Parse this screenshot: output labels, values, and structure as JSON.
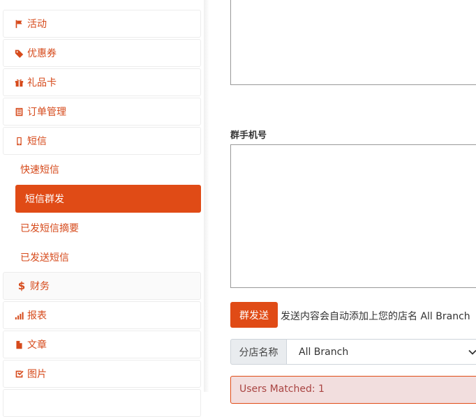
{
  "sidebar": {
    "items": [
      {
        "label": "活动",
        "icon": "flag-icon"
      },
      {
        "label": "优惠券",
        "icon": "tags-icon"
      },
      {
        "label": "礼品卡",
        "icon": "gift-icon"
      },
      {
        "label": "订单管理",
        "icon": "list-icon"
      },
      {
        "label": "短信",
        "icon": "mobile-icon"
      },
      {
        "label": "财务",
        "icon": "dollar-icon"
      },
      {
        "label": "报表",
        "icon": "bar-chart-icon"
      },
      {
        "label": "文章",
        "icon": "file-icon"
      },
      {
        "label": "图片",
        "icon": "check-square-icon"
      }
    ],
    "sms_submenu": [
      {
        "label": "快速短信",
        "active": false
      },
      {
        "label": "短信群发",
        "active": true
      },
      {
        "label": "已发短信摘要",
        "active": false
      },
      {
        "label": "已发送短信",
        "active": false
      }
    ]
  },
  "main": {
    "phones_label": "群手机号",
    "send_button": "群发送",
    "send_note": "发送内容会自动添加上您的店名 All Branch",
    "branch_addon": "分店名称",
    "branch_selected": "All Branch",
    "alert_text": "Users Matched: 1"
  },
  "colors": {
    "accent": "#e04b16",
    "text_accent": "#d64a1b"
  }
}
